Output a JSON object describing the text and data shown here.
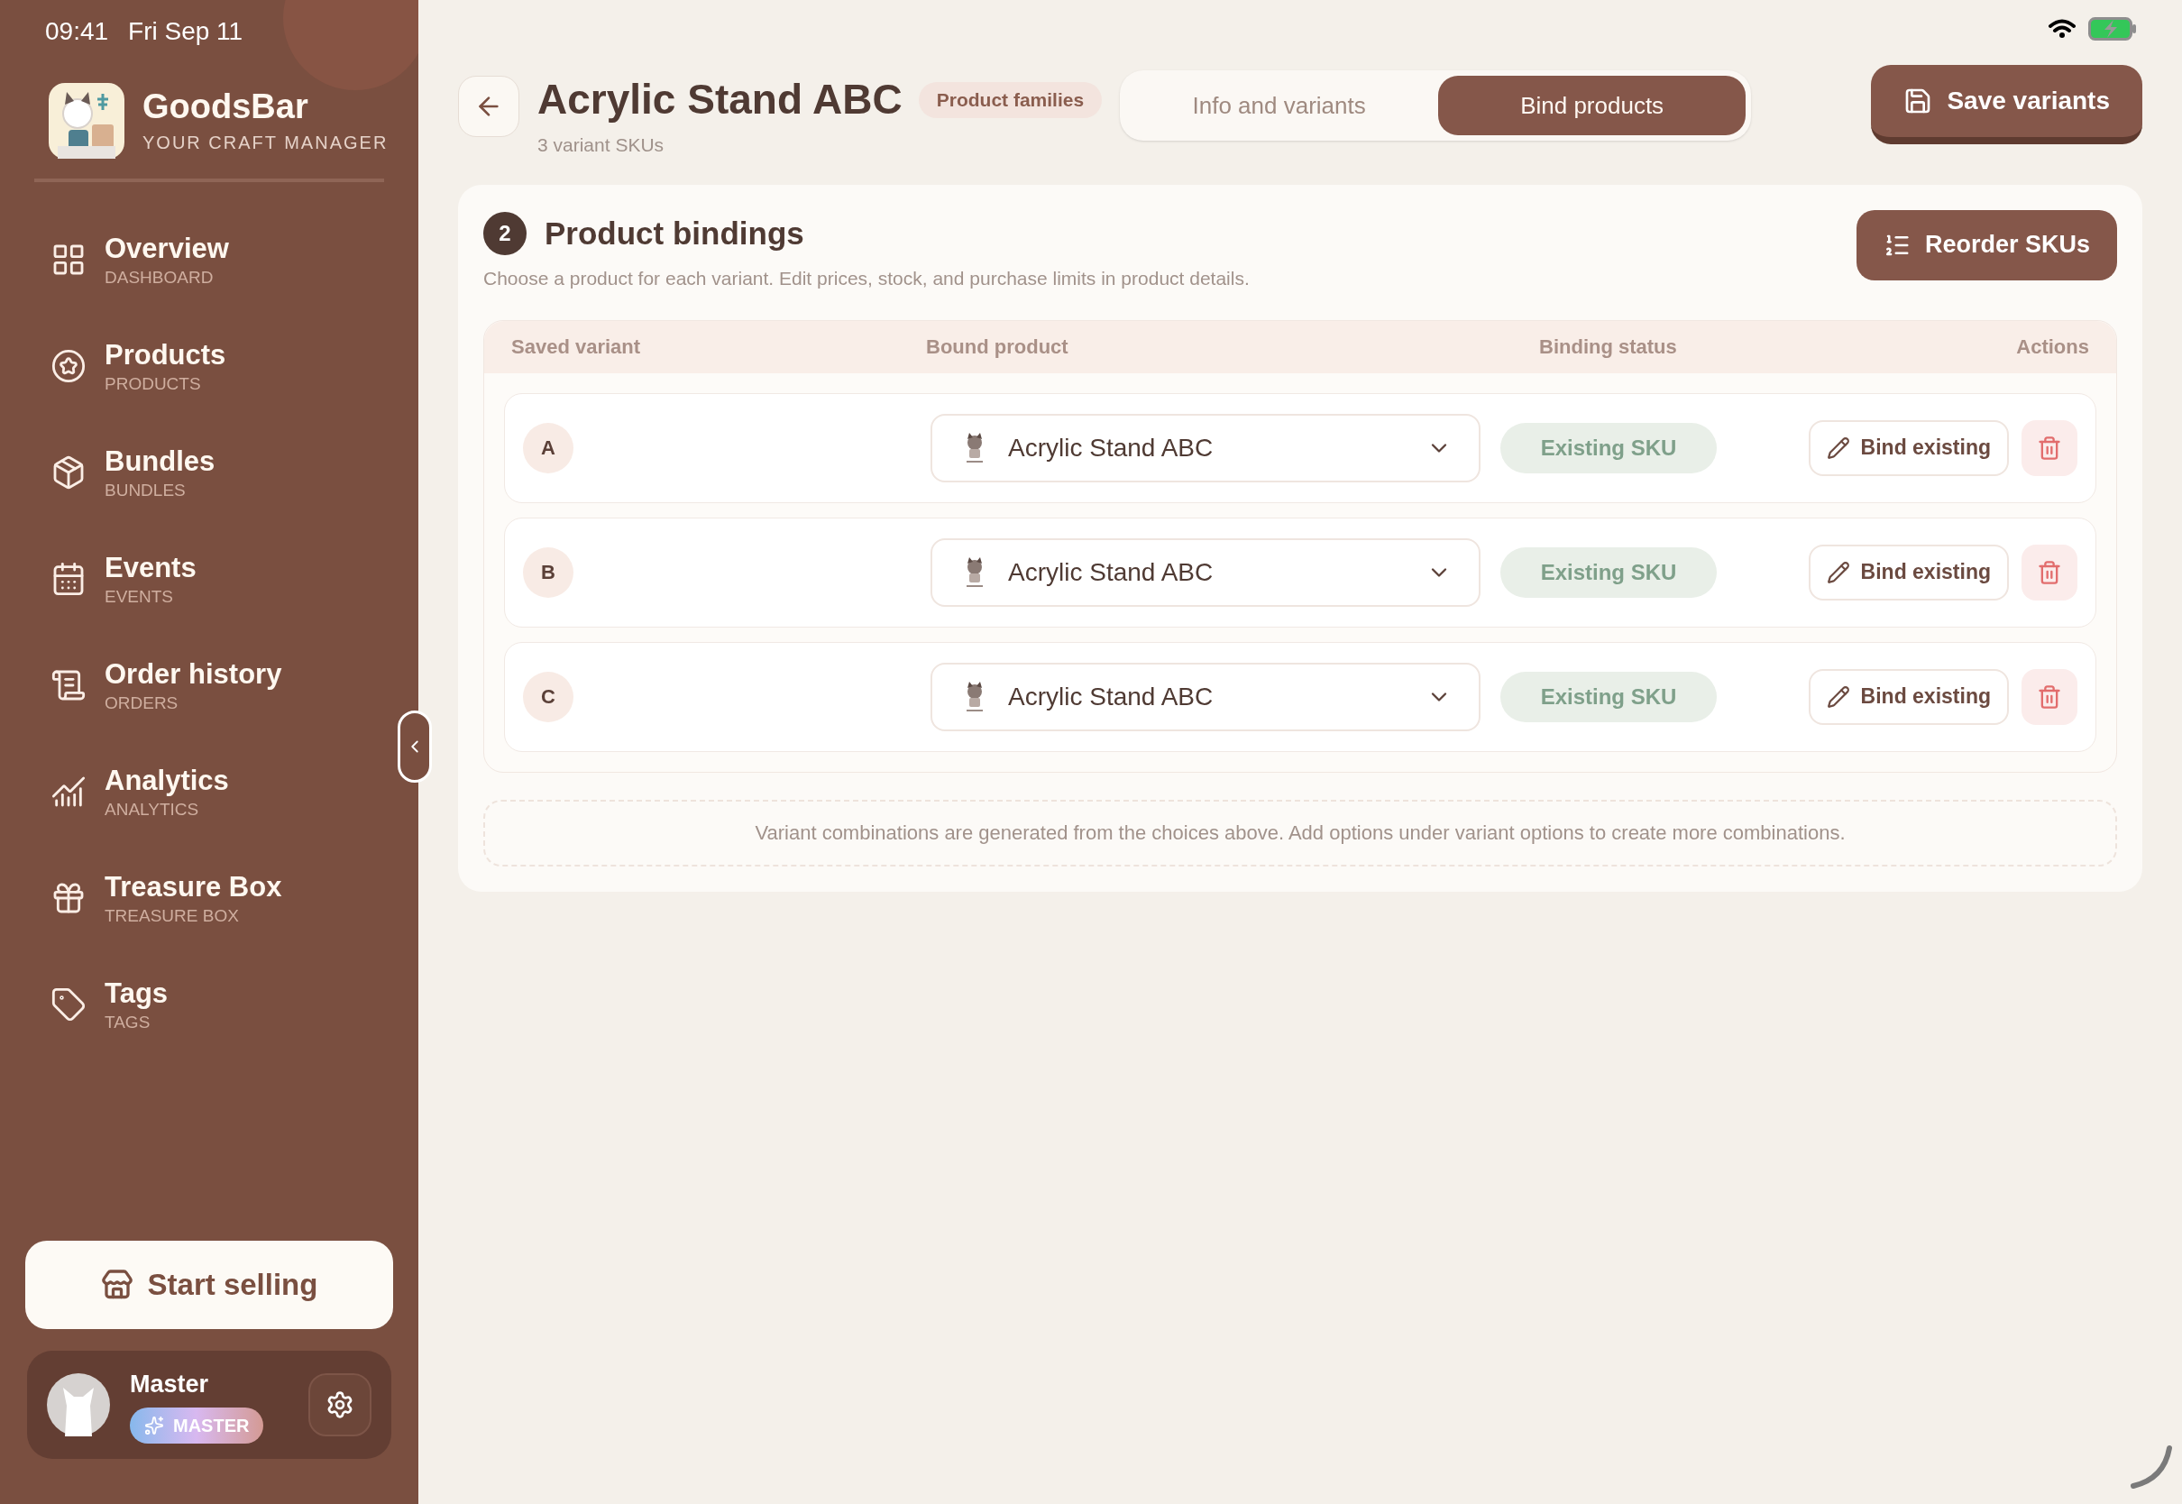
{
  "status_bar": {
    "time": "09:41",
    "date": "Fri Sep 11"
  },
  "brand": {
    "name": "GoodsBar",
    "tagline": "YOUR CRAFT MANAGER"
  },
  "sidebar": {
    "items": [
      {
        "kind": "overview",
        "label": "Overview",
        "sublabel": "DASHBOARD"
      },
      {
        "kind": "products",
        "label": "Products",
        "sublabel": "PRODUCTS"
      },
      {
        "kind": "bundles",
        "label": "Bundles",
        "sublabel": "BUNDLES"
      },
      {
        "kind": "events",
        "label": "Events",
        "sublabel": "EVENTS"
      },
      {
        "kind": "orders",
        "label": "Order history",
        "sublabel": "ORDERS"
      },
      {
        "kind": "analytics",
        "label": "Analytics",
        "sublabel": "ANALYTICS"
      },
      {
        "kind": "treasure",
        "label": "Treasure Box",
        "sublabel": "TREASURE BOX"
      },
      {
        "kind": "tags",
        "label": "Tags",
        "sublabel": "TAGS"
      }
    ],
    "start_button": "Start selling",
    "user": {
      "name": "Master",
      "badge": "MASTER"
    }
  },
  "header": {
    "title": "Acrylic Stand ABC",
    "badge": "Product families",
    "subtitle": "3 variant SKUs",
    "tabs": [
      {
        "label": "Info and variants",
        "selected": false
      },
      {
        "label": "Bind products",
        "selected": true
      }
    ],
    "save_button": "Save variants"
  },
  "bindings": {
    "step": "2",
    "title": "Product bindings",
    "description": "Choose a product for each variant. Edit prices, stock, and purchase limits in product details.",
    "reorder_button": "Reorder SKUs",
    "columns": [
      "Saved variant",
      "Bound product",
      "Binding status",
      "Actions"
    ],
    "rows": [
      {
        "variant": "A",
        "product": "Acrylic Stand ABC",
        "status": "Existing SKU",
        "action": "Bind existing"
      },
      {
        "variant": "B",
        "product": "Acrylic Stand ABC",
        "status": "Existing SKU",
        "action": "Bind existing"
      },
      {
        "variant": "C",
        "product": "Acrylic Stand ABC",
        "status": "Existing SKU",
        "action": "Bind existing"
      }
    ],
    "note": "Variant combinations are generated from the choices above. Add options under variant options to create more combinations."
  }
}
